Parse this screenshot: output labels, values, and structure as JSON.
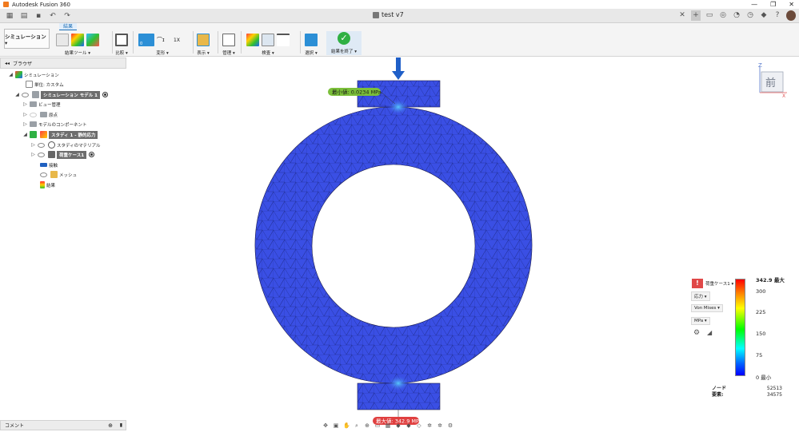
{
  "app": {
    "title": "Autodesk Fusion 360",
    "doc_title": "test v7"
  },
  "window_controls": [
    "—",
    "❐",
    "✕"
  ],
  "ribbon": {
    "workspace": "シミュレーション ▾",
    "active_tab": "結果",
    "groups": [
      {
        "label": "結果ツール ▾"
      },
      {
        "label": "比較 ▾"
      },
      {
        "label": "変形 ▾"
      },
      {
        "label": "表示 ▾"
      },
      {
        "label": "管理 ▾"
      },
      {
        "label": "検査 ▾"
      },
      {
        "label": "選択 ▾"
      },
      {
        "label": "結果を終了 ▾"
      }
    ],
    "deform_values": {
      "zero": "0",
      "actual": "1X"
    }
  },
  "browser": {
    "title": "ブラウザ",
    "items": [
      {
        "label": "シミュレーション"
      },
      {
        "label": "単位: カスタム"
      },
      {
        "label": "シミュレーション モデル 1"
      },
      {
        "label": "ビュー管理"
      },
      {
        "label": "原点"
      },
      {
        "label": "モデルのコンポーネント"
      },
      {
        "label": "スタディ 1 - 静的応力"
      },
      {
        "label": "スタディのマテリアル"
      },
      {
        "label": "荷重ケース1"
      },
      {
        "label": "接触"
      },
      {
        "label": "メッシュ"
      },
      {
        "label": "結果"
      }
    ]
  },
  "comment": {
    "label": "コメント"
  },
  "viewport": {
    "min_label": "最小値: 0.0234 MPa",
    "max_label_partial": "最大値: 342.9 MPa",
    "viewcube": {
      "face": "前",
      "axis_z": "Z",
      "axis_x": "X"
    }
  },
  "legend": {
    "load_case": "荷重ケース1 ▾",
    "result_type": "応力 ▾",
    "component": "Von Mises ▾",
    "unit": "MPa ▾",
    "max_label": "342.9 最大",
    "ticks": [
      "300",
      "225",
      "150",
      "75"
    ],
    "min_label": "0 最小",
    "colors": {
      "high": "#ff0000",
      "low": "#0000ff",
      "model": "#3a4fe4"
    }
  },
  "stats": {
    "nodes_label": "ノード",
    "nodes": "52513",
    "elements_label": "要素:",
    "elements": "34575"
  }
}
